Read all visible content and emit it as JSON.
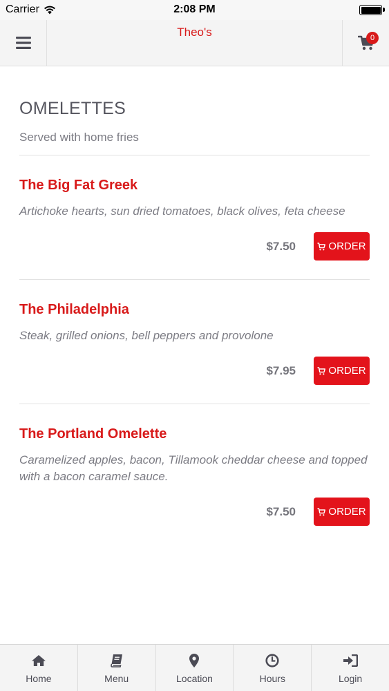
{
  "status_bar": {
    "carrier": "Carrier",
    "time": "2:08 PM"
  },
  "header": {
    "title": "Theo's",
    "cart_count": "0",
    "menu_icon": "hamburger-icon",
    "cart_icon": "shopping-cart-icon"
  },
  "section": {
    "title": "OMELETTES",
    "subtitle": "Served with home fries"
  },
  "items": [
    {
      "name": "The Big Fat Greek",
      "description": "Artichoke hearts, sun dried tomatoes, black olives, feta cheese",
      "price": "$7.50",
      "order_label": "ORDER"
    },
    {
      "name": "The Philadelphia",
      "description": "Steak, grilled onions, bell peppers and provolone",
      "price": "$7.95",
      "order_label": "ORDER"
    },
    {
      "name": "The Portland Omelette",
      "description": "Caramelized apples, bacon, Tillamook cheddar cheese and topped with a bacon caramel sauce.",
      "price": "$7.50",
      "order_label": "ORDER"
    }
  ],
  "tabs": [
    {
      "label": "Home",
      "icon": "home-icon"
    },
    {
      "label": "Menu",
      "icon": "book-icon"
    },
    {
      "label": "Location",
      "icon": "map-marker-icon"
    },
    {
      "label": "Hours",
      "icon": "clock-icon"
    },
    {
      "label": "Login",
      "icon": "sign-in-icon"
    }
  ],
  "colors": {
    "brand": "#d81a1a",
    "order_button": "#e3131b",
    "text_muted": "#7c7c84"
  }
}
